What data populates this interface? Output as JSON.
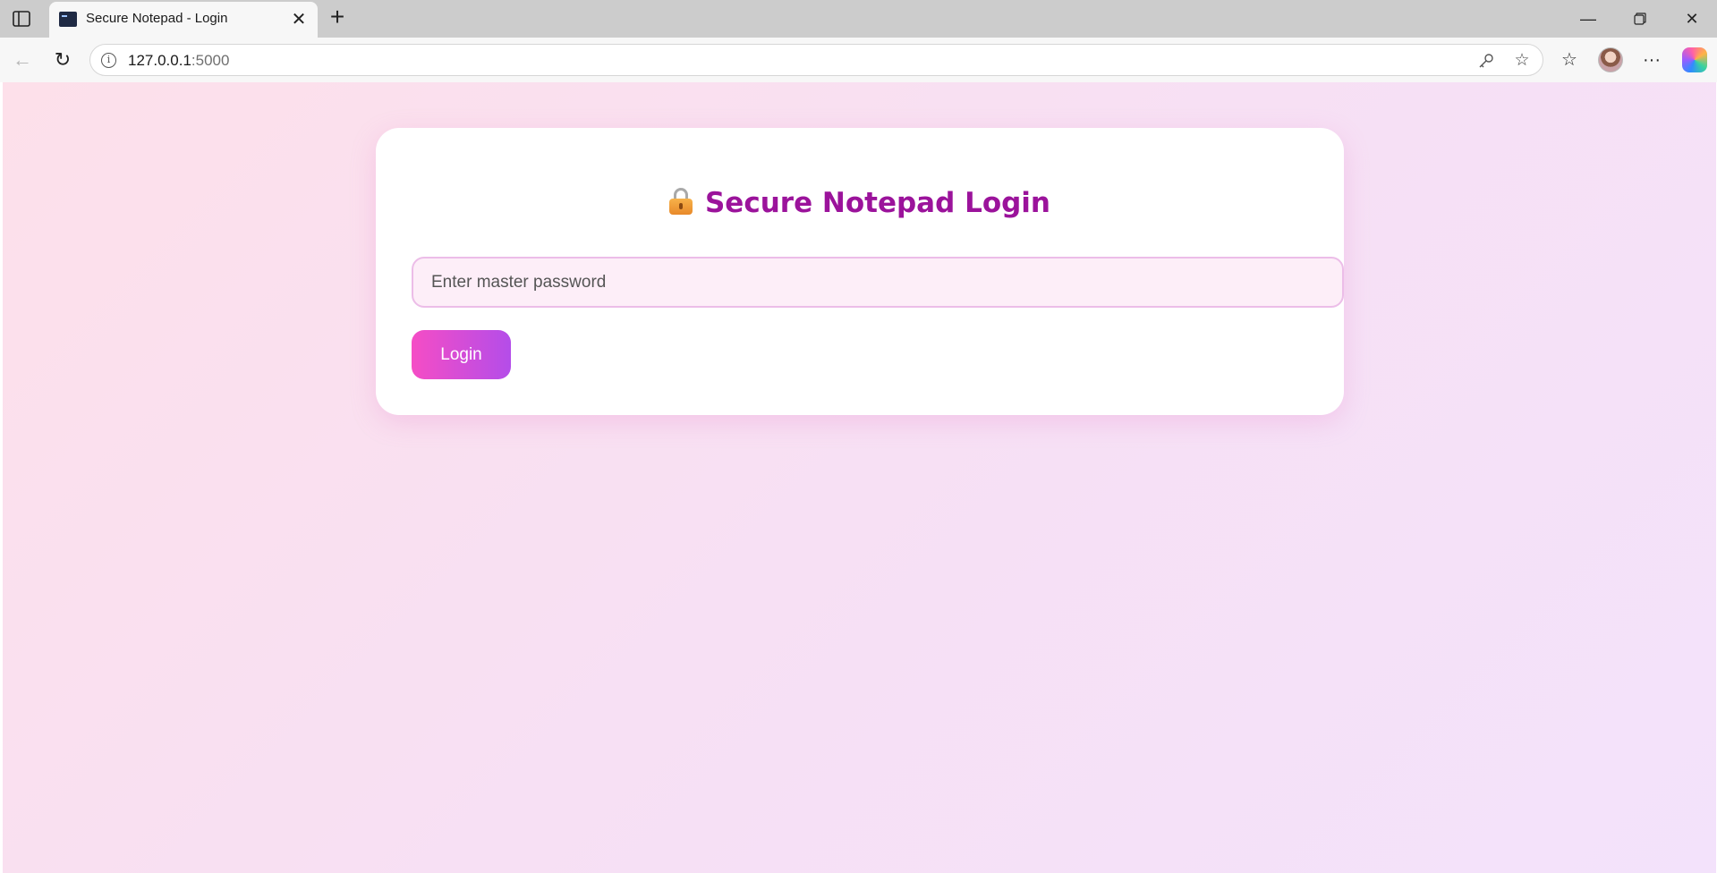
{
  "browser": {
    "tab": {
      "title": "Secure Notepad - Login",
      "favicon": "terminal-icon"
    },
    "address": {
      "host": "127.0.0.1",
      "port": ":5000"
    },
    "icons": {
      "sidebar": "tab-actions-icon",
      "close_tab": "close-icon",
      "new_tab": "plus-icon",
      "back": "back-arrow-icon",
      "refresh": "refresh-icon",
      "site_info": "info-icon",
      "password_key": "key-icon",
      "favorite": "star-icon",
      "favorites_list": "favorites-icon",
      "more": "more-icon",
      "minimize": "minimize-icon",
      "restore": "restore-icon",
      "close_window": "close-icon"
    }
  },
  "login": {
    "title": "Secure Notepad Login",
    "title_icon": "lock-icon",
    "password_placeholder": "Enter master password",
    "password_value": "",
    "submit_label": "Login"
  },
  "colors": {
    "title": "#9b139b",
    "button_gradient_start": "#f54dc5",
    "button_gradient_end": "#b44de9",
    "input_background": "#fdeef8",
    "input_border": "#ecbde8",
    "page_background_start": "#fde0ea",
    "page_background_end": "#f3e2fb"
  }
}
